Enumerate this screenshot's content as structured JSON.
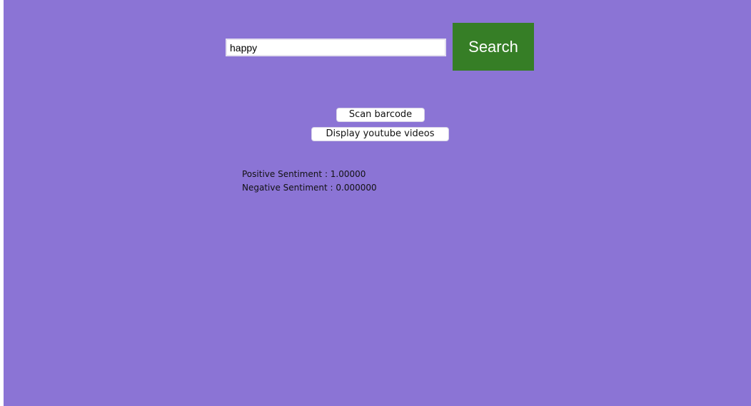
{
  "search": {
    "query": "happy",
    "button_label": "Search"
  },
  "actions": {
    "scan_barcode_label": "Scan barcode",
    "youtube_label": "Display youtube videos"
  },
  "results": {
    "positive_label": "Positive Sentiment",
    "positive_value": "1.00000",
    "negative_label": "Negative Sentiment",
    "negative_value": "0.000000"
  },
  "colors": {
    "background": "#8b74d5",
    "search_button": "#367e26"
  }
}
